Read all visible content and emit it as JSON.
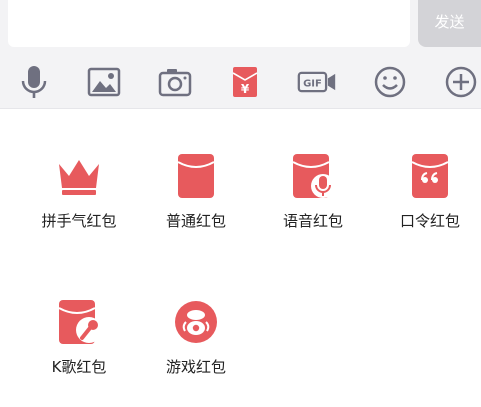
{
  "input": {
    "placeholder": "",
    "send_label": "发送"
  },
  "toolbar": {
    "items": [
      {
        "icon": "microphone-icon"
      },
      {
        "icon": "image-icon"
      },
      {
        "icon": "camera-icon"
      },
      {
        "icon": "red-packet-icon"
      },
      {
        "icon": "gif-icon",
        "text": "GIF"
      },
      {
        "icon": "emoji-icon"
      },
      {
        "icon": "plus-icon"
      }
    ]
  },
  "packets": {
    "items": [
      {
        "label": "拼手气红包",
        "icon": "crown-icon"
      },
      {
        "label": "普通红包",
        "icon": "envelope-icon"
      },
      {
        "label": "语音红包",
        "icon": "envelope-mic-icon"
      },
      {
        "label": "口令红包",
        "icon": "envelope-quote-icon"
      },
      {
        "label": "K歌红包",
        "icon": "envelope-karaoke-icon"
      },
      {
        "label": "游戏红包",
        "icon": "game-icon"
      }
    ]
  },
  "colors": {
    "accent": "#e75a5d",
    "toolbar_icon": "#6f7080",
    "toolbar_bg": "#f3f3f5"
  }
}
